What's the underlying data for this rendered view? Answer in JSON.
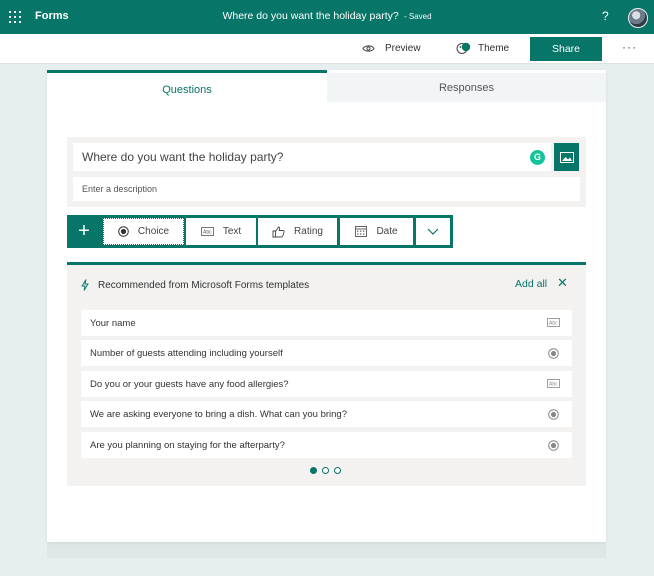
{
  "app": {
    "name": "Forms"
  },
  "header": {
    "form_title": "Where do you want the holiday party?",
    "save_status": "Saved",
    "help_label": "?"
  },
  "commands": {
    "preview_label": "Preview",
    "theme_label": "Theme",
    "share_label": "Share",
    "more_label": "···"
  },
  "tabs": [
    {
      "label": "Questions",
      "active": true
    },
    {
      "label": "Responses",
      "active": false
    }
  ],
  "question": {
    "title_value": "Where do you want the holiday party?",
    "description_placeholder": "Enter a description",
    "grammarly_badge": "G"
  },
  "question_types": [
    {
      "label": "Choice",
      "icon": "radio-icon",
      "selected": true
    },
    {
      "label": "Text",
      "icon": "text-abc-icon",
      "selected": false
    },
    {
      "label": "Rating",
      "icon": "thumbs-up-icon",
      "selected": false
    },
    {
      "label": "Date",
      "icon": "calendar-icon",
      "selected": false
    }
  ],
  "add_button_label": "+",
  "recommendations": {
    "heading": "Recommended from Microsoft Forms templates",
    "add_all_label": "Add all",
    "close_label": "✕",
    "items": [
      {
        "label": "Your name",
        "icon": "text-abc-icon"
      },
      {
        "label": "Number of guests attending including yourself",
        "icon": "radio-icon"
      },
      {
        "label": "Do you or your guests have any food allergies?",
        "icon": "text-abc-icon"
      },
      {
        "label": "We are asking everyone to bring a dish. What can you bring?",
        "icon": "radio-icon"
      },
      {
        "label": "Are you planning on staying for the afterparty?",
        "icon": "radio-icon"
      }
    ],
    "pages": 3,
    "current_page": 1
  },
  "colors": {
    "accent": "#077568",
    "page_bg": "#e7eef0"
  }
}
